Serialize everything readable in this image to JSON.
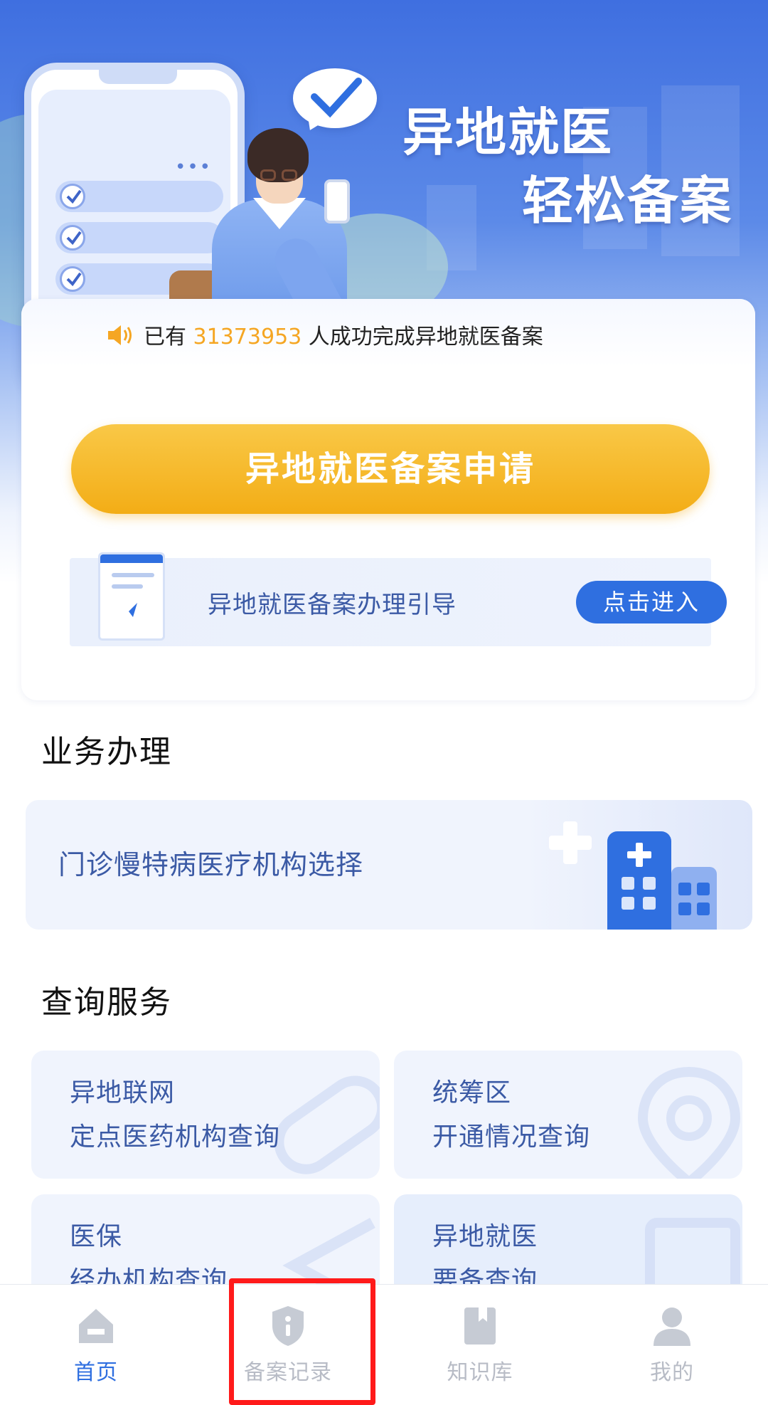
{
  "hero": {
    "title_line1": "异地就医",
    "title_line2": "轻松备案"
  },
  "notice": {
    "prefix": "已有",
    "count": "31373953",
    "suffix": "人成功完成异地就医备案"
  },
  "apply_button": "异地就医备案申请",
  "guide": {
    "text": "异地就医备案办理引导",
    "button": "点击进入"
  },
  "business": {
    "title": "业务办理",
    "item": "门诊慢特病医疗机构选择"
  },
  "query": {
    "title": "查询服务",
    "cards": [
      {
        "line1": "异地联网",
        "line2": "定点医药机构查询"
      },
      {
        "line1": "统筹区",
        "line2": "开通情况查询"
      },
      {
        "line1": "医保",
        "line2": "经办机构查询"
      },
      {
        "line1": "异地就医",
        "line2": "要备查询"
      }
    ]
  },
  "tabbar": {
    "items": [
      {
        "label": "首页",
        "icon": "home-icon",
        "active": true
      },
      {
        "label": "备案记录",
        "icon": "record-shield-icon",
        "active": false
      },
      {
        "label": "知识库",
        "icon": "book-icon",
        "active": false
      },
      {
        "label": "我的",
        "icon": "profile-icon",
        "active": false
      }
    ]
  },
  "colors": {
    "primary": "#2f6fe0",
    "accent_yellow": "#f3ad16",
    "count_orange": "#f5a623",
    "highlight_red": "#ff1a1a"
  }
}
